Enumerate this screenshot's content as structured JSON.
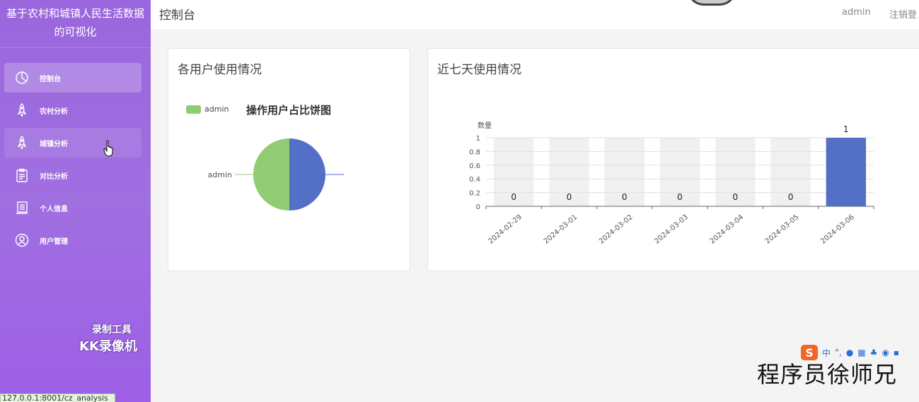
{
  "app": {
    "title": "基于农村和城镇人民生活数据的可视化"
  },
  "header": {
    "page_title": "控制台",
    "user": "admin",
    "logout": "注销登"
  },
  "sidebar": {
    "items": [
      {
        "label": "控制台",
        "icon": "dashboard-icon",
        "active": true
      },
      {
        "label": "农村分析",
        "icon": "rocket-icon"
      },
      {
        "label": "城镇分析",
        "icon": "rocket-icon",
        "hover": true
      },
      {
        "label": "对比分析",
        "icon": "clipboard-icon"
      },
      {
        "label": "个人信息",
        "icon": "profile-icon"
      },
      {
        "label": "用户管理",
        "icon": "user-circle-icon"
      }
    ]
  },
  "overlay": {
    "watermark_line1": "录制工具",
    "watermark_line2": "KK录像机",
    "status_url": "127.0.0.1:8001/cz_analysis",
    "ime_logo": "S",
    "ime_text": "中",
    "signature": "程序员徐师兄"
  },
  "colors": {
    "sidebar": "#9a66dd",
    "pie_green": "#91cc75",
    "pie_blue": "#5470c6",
    "bar_blue": "#5470c6"
  },
  "cards": {
    "users": {
      "title": "各用户使用情况",
      "legend": "admin",
      "chart_title": "操作用户占比饼图",
      "slice_label": "admin"
    },
    "week": {
      "title": "近七天使用情况",
      "ylabel": "数量"
    }
  },
  "chart_data": [
    {
      "type": "pie",
      "title": "操作用户占比饼图",
      "series": [
        {
          "name": "admin",
          "values": [
            1
          ]
        }
      ],
      "legend": [
        "admin"
      ],
      "legend_position": "top-left"
    },
    {
      "type": "bar",
      "categories": [
        "2024-02-29",
        "2024-03-01",
        "2024-03-02",
        "2024-03-03",
        "2024-03-04",
        "2024-03-05",
        "2024-03-06"
      ],
      "values": [
        0,
        0,
        0,
        0,
        0,
        0,
        1
      ],
      "ylabel": "数量",
      "ylim": [
        0,
        1
      ],
      "yticks": [
        "0",
        "0.2",
        "0.4",
        "0.6",
        "0.8",
        "1"
      ],
      "grid": true,
      "background_bars": true,
      "data_labels": true
    }
  ]
}
